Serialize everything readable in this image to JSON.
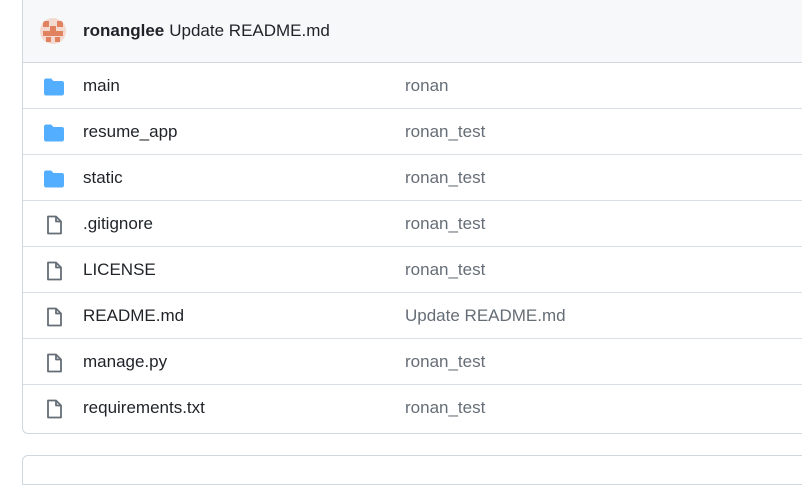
{
  "latest_commit": {
    "author": "ronanglee",
    "message": "Update README.md"
  },
  "files": [
    {
      "name": "main",
      "type": "folder",
      "commit": "ronan"
    },
    {
      "name": "resume_app",
      "type": "folder",
      "commit": "ronan_test"
    },
    {
      "name": "static",
      "type": "folder",
      "commit": "ronan_test"
    },
    {
      "name": ".gitignore",
      "type": "file",
      "commit": "ronan_test"
    },
    {
      "name": "LICENSE",
      "type": "file",
      "commit": "ronan_test"
    },
    {
      "name": "README.md",
      "type": "file",
      "commit": "Update README.md"
    },
    {
      "name": "manage.py",
      "type": "file",
      "commit": "ronan_test"
    },
    {
      "name": "requirements.txt",
      "type": "file",
      "commit": "ronan_test"
    }
  ],
  "colors": {
    "folder_icon": "#54aeff",
    "file_icon": "#656d76",
    "avatar": "#e0815f"
  }
}
